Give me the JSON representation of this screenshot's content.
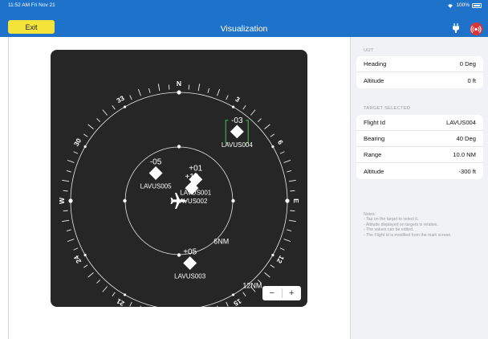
{
  "status": {
    "time": "11:52 AM  Fri Nov 21",
    "battery": "100%"
  },
  "nav": {
    "exit_label": "Exit",
    "title": "Visualization"
  },
  "compass": {
    "labels": [
      {
        "text": "N",
        "bearing": 0
      },
      {
        "text": "3",
        "bearing": 30
      },
      {
        "text": "6",
        "bearing": 60
      },
      {
        "text": "E",
        "bearing": 90
      },
      {
        "text": "12",
        "bearing": 120
      },
      {
        "text": "15",
        "bearing": 150
      },
      {
        "text": "S",
        "bearing": 180
      },
      {
        "text": "21",
        "bearing": 210
      },
      {
        "text": "24",
        "bearing": 240
      },
      {
        "text": "W",
        "bearing": 270
      },
      {
        "text": "30",
        "bearing": 300
      },
      {
        "text": "33",
        "bearing": 330
      }
    ],
    "ranges": [
      {
        "text": "6NM",
        "nm": 6
      },
      {
        "text": "12NM",
        "nm": 12
      }
    ]
  },
  "targets": [
    {
      "id": "LAVUS004",
      "alt": "-03",
      "bearing": 40,
      "range_nm": 10,
      "selected": true
    },
    {
      "id": "LAVUS005",
      "alt": "-05",
      "bearing": 320,
      "range_nm": 4
    },
    {
      "id": "LAVUS001",
      "alt": "+01",
      "bearing": 38,
      "range_nm": 3
    },
    {
      "id": "LAVUS002",
      "alt": "+10",
      "bearing": 45,
      "range_nm": 2
    },
    {
      "id": "LAVUS003",
      "alt": "+05",
      "bearing": 170,
      "range_nm": 7
    }
  ],
  "zoom": {
    "minus": "−",
    "plus": "+"
  },
  "uut": {
    "section_title": "UUT",
    "rows": [
      {
        "label": "Heading",
        "value": "0 Deg"
      },
      {
        "label": "Altitude",
        "value": "0 ft"
      }
    ]
  },
  "target_selected": {
    "section_title": "TARGET SELECTED",
    "rows": [
      {
        "label": "Flight Id",
        "value": "LAVUS004"
      },
      {
        "label": "Bearing",
        "value": "40 Deg"
      },
      {
        "label": "Range",
        "value": "10.0 NM"
      },
      {
        "label": "Altitude",
        "value": "-300 ft"
      }
    ]
  },
  "notes": [
    "Notes:",
    "- Tap on the target to select it.",
    "- Altitude displayed on targets is relative.",
    "- The values can be edited.",
    "- The Flight Id is modified from the main screen."
  ],
  "colors": {
    "accent": "#1e72c9",
    "exit": "#f4e43a",
    "alarm": "#d8373a",
    "selection": "#2e9e4f",
    "radar_bg": "#262626"
  }
}
